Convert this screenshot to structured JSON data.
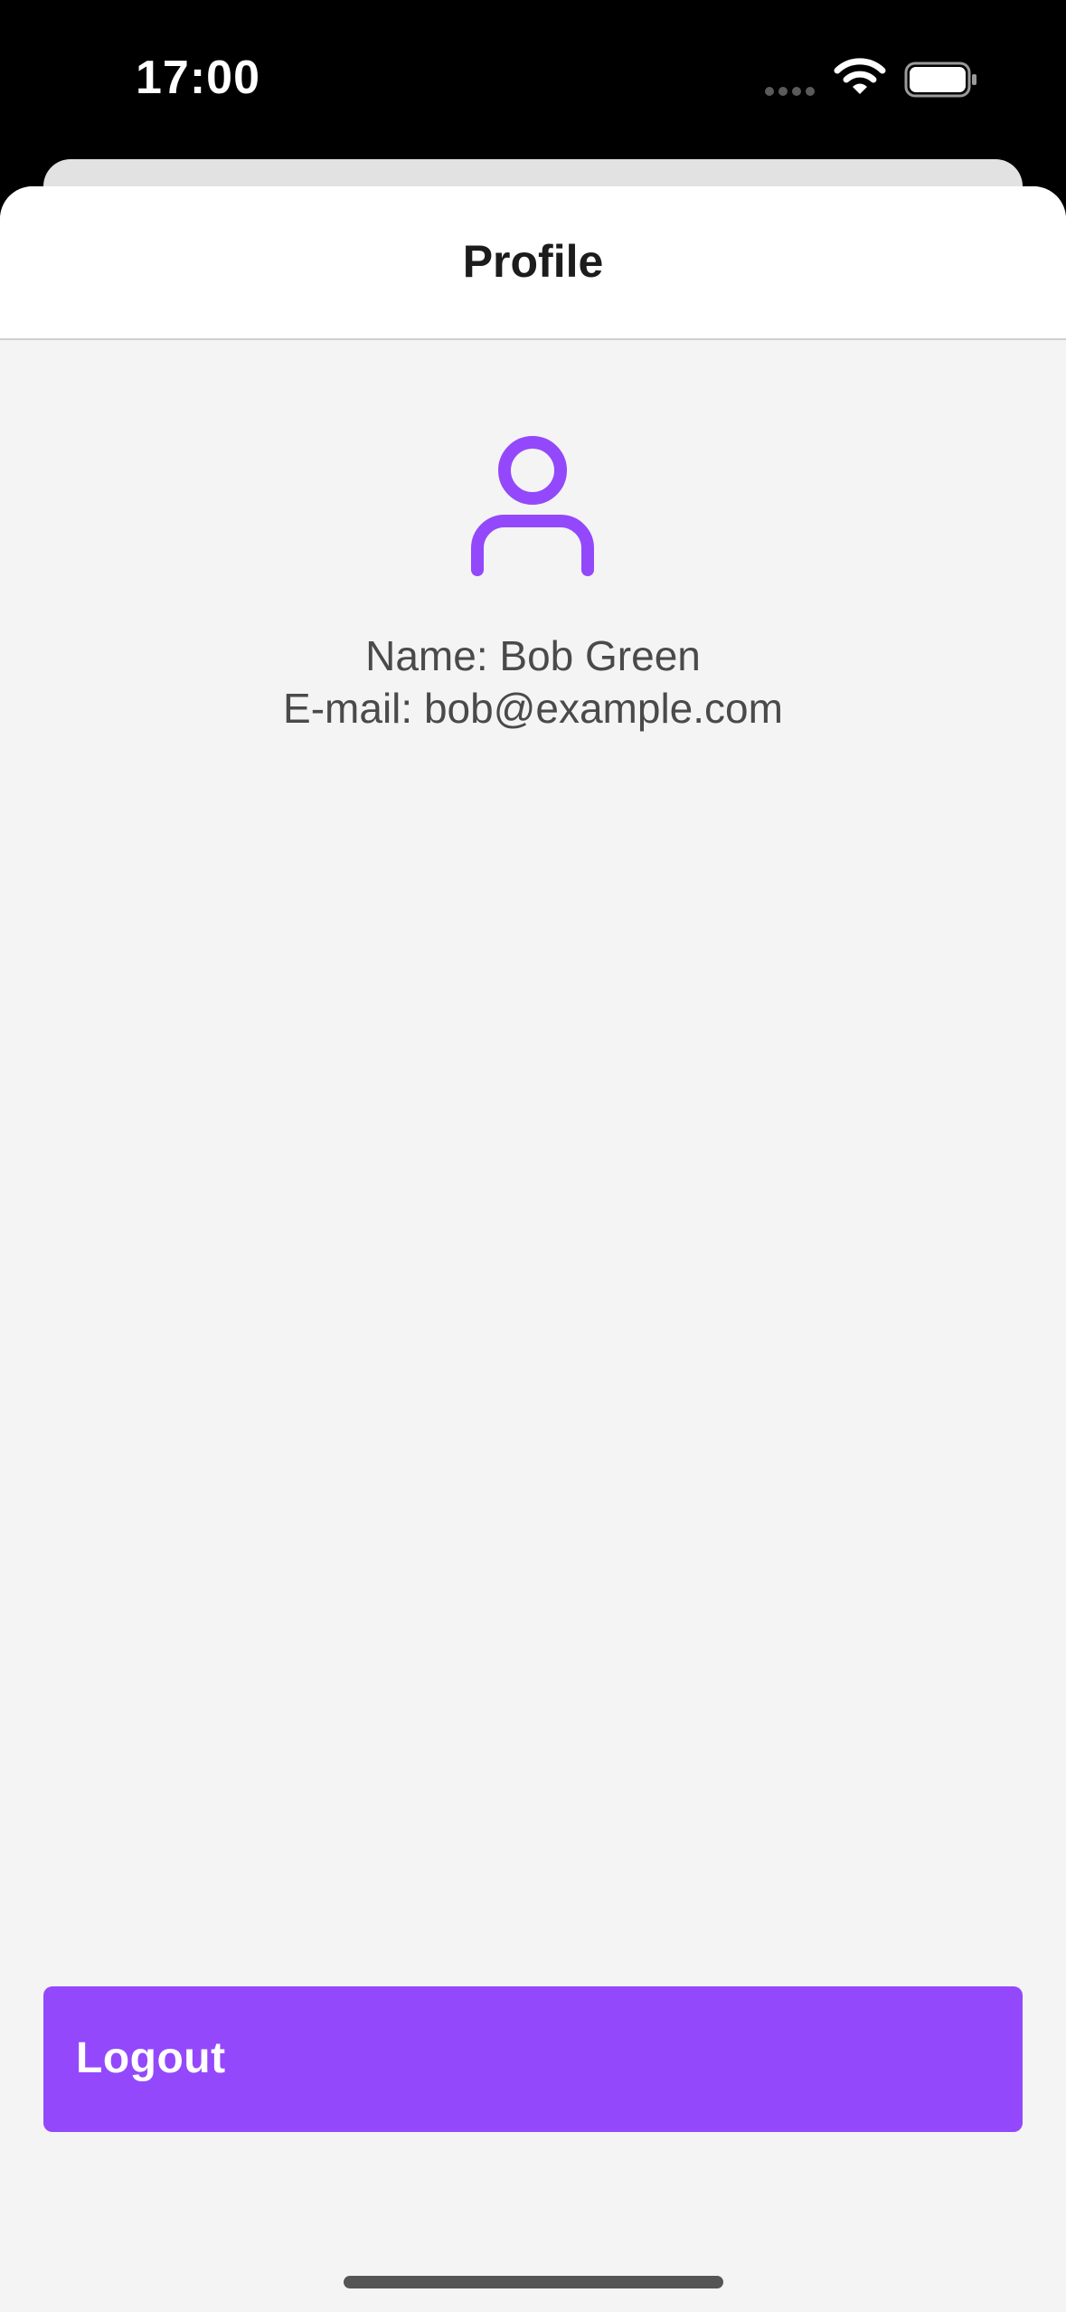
{
  "status_bar": {
    "time": "17:00",
    "icons": [
      "signal-dots-icon",
      "wifi-icon",
      "battery-icon"
    ]
  },
  "header": {
    "title": "Profile"
  },
  "profile": {
    "avatar_icon": "person-icon",
    "name_line": "Name: Bob Green",
    "email_line": "E-mail: bob@example.com"
  },
  "actions": {
    "logout_label": "Logout"
  },
  "colors": {
    "accent": "#9448fb",
    "background": "#f4f4f4",
    "header_background": "#ffffff",
    "text": "#4a4a4a",
    "title_text": "#1c1c1c"
  }
}
